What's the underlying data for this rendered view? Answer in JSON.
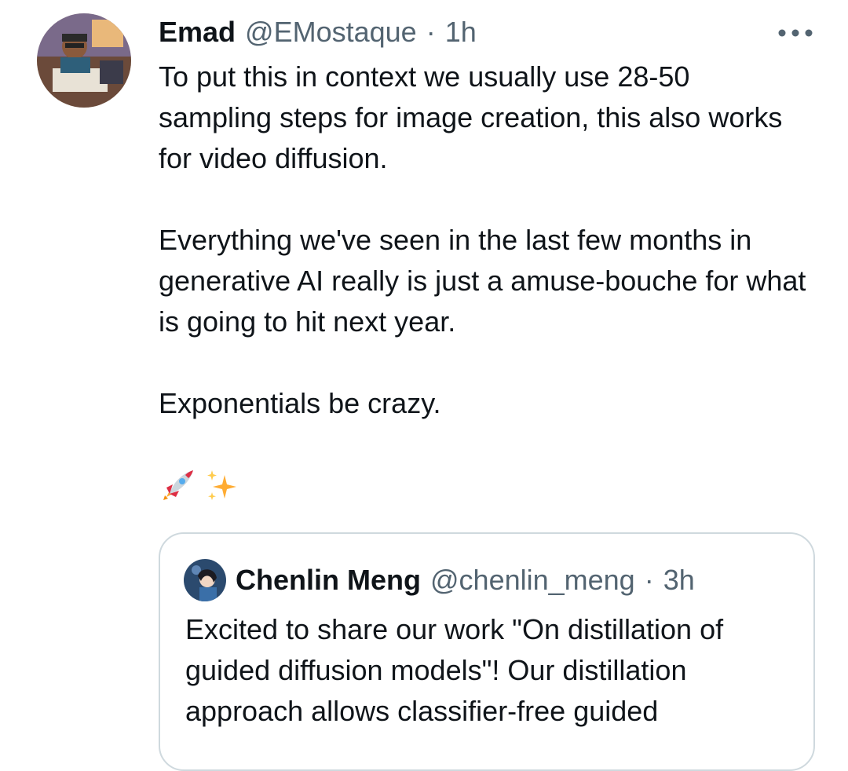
{
  "tweet": {
    "author_name": "Emad",
    "author_handle": "@EMostaque",
    "separator": "·",
    "timestamp": "1h",
    "more_label": "More",
    "paragraphs": [
      "To put this in context we usually use 28-50 sampling steps for image creation, this also works for video diffusion.",
      "Everything we've seen in the last few months in generative AI really is just a amuse-bouche for what is going to hit next year.",
      "Exponentials be crazy."
    ],
    "emojis": [
      "rocket-emoji",
      "sparkles-emoji"
    ]
  },
  "quote": {
    "author_name": "Chenlin Meng",
    "author_handle": "@chenlin_meng",
    "separator": "·",
    "timestamp": "3h",
    "text": "Excited to share our work \"On distillation of guided diffusion models\"! Our distillation approach allows classifier-free guided"
  },
  "colors": {
    "text_primary": "#0f1419",
    "text_secondary": "#536471",
    "border": "#cfd9de"
  }
}
